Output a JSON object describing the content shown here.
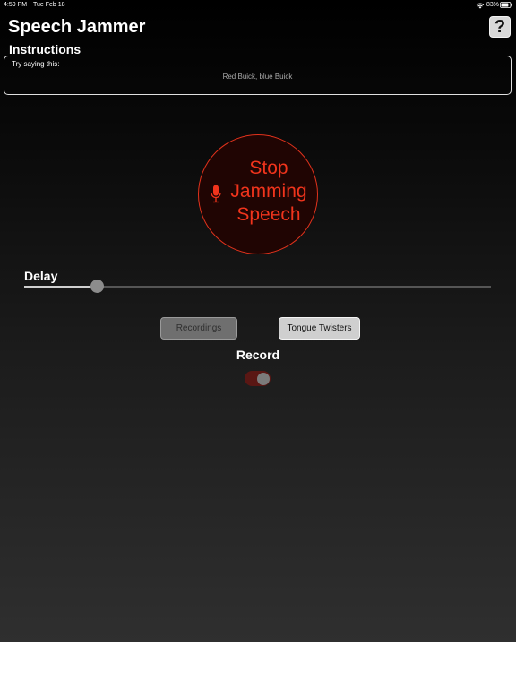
{
  "status_bar": {
    "time": "4:59 PM",
    "date": "Tue Feb 18",
    "battery_percent": "83%",
    "battery_level": 0.83
  },
  "header": {
    "title": "Speech Jammer",
    "help_label": "?"
  },
  "instructions": {
    "label": "Instructions",
    "prompt": "Try saying this:",
    "phrase": "Red Buick, blue Buick"
  },
  "jam_button": {
    "lines": [
      "Stop",
      "Jamming",
      "Speech"
    ],
    "icon": "microphone-icon"
  },
  "delay": {
    "label": "Delay",
    "value": 0.155
  },
  "buttons": {
    "recordings": "Recordings",
    "tongue_twisters": "Tongue Twisters"
  },
  "record": {
    "label": "Record",
    "on": true
  },
  "colors": {
    "accent_red": "#f0341c",
    "background": "#000000"
  }
}
